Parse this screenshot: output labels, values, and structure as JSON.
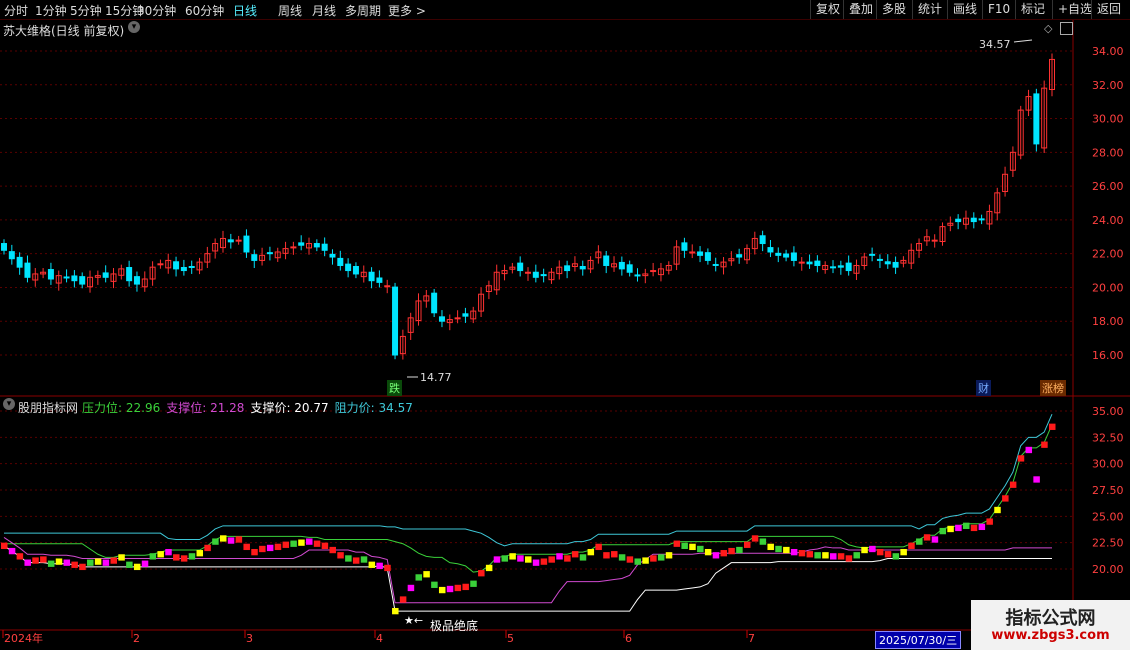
{
  "toolbar": {
    "periods": [
      "分时",
      "1分钟",
      "5分钟",
      "15分钟",
      "30分钟",
      "60分钟",
      "日线",
      "周线",
      "月线",
      "多周期",
      "更多 >"
    ],
    "active_period": "日线",
    "right_buttons": [
      "复权",
      "叠加",
      "多股",
      "统计",
      "画线",
      "F10",
      "标记",
      "+自选",
      "返回"
    ]
  },
  "main_chart": {
    "title": "苏大维格(日线 前复权)",
    "price_axis": [
      "34.00",
      "32.00",
      "30.00",
      "28.00",
      "26.00",
      "24.00",
      "22.00",
      "20.00",
      "18.00",
      "16.00"
    ],
    "high_marker": "34.57",
    "low_marker": "14.77",
    "badges": {
      "fall": "跌",
      "finance": "财",
      "limit_list": "涨榜"
    }
  },
  "indicator": {
    "name": "股朋指标网",
    "items": [
      {
        "label": "压力位:",
        "value": "22.96",
        "color": "#3ad13a"
      },
      {
        "label": "支撑位:",
        "value": "21.28",
        "color": "#d04ad0"
      },
      {
        "label": "支撑价:",
        "value": "20.77",
        "color": "#ffffff"
      },
      {
        "label": "阻力价:",
        "value": "34.57",
        "color": "#3ec8d8"
      }
    ],
    "axis": [
      "35.00",
      "32.50",
      "30.00",
      "27.50",
      "25.00",
      "22.50",
      "20.00"
    ],
    "annotation": "极品绝底"
  },
  "time_axis": {
    "labels": [
      "2024年",
      "2",
      "3",
      "4",
      "5",
      "6",
      "7"
    ],
    "cursor_date": "2025/07/30/三"
  },
  "watermark": {
    "title": "指标公式网",
    "url": "www.zbgs3.com"
  },
  "colors": {
    "up": "#ff3232",
    "down": "#00e5ff",
    "grid": "#5a0000",
    "axis_text": "#ff4040"
  },
  "series": {
    "closes": [
      22.2,
      21.7,
      21.2,
      20.6,
      20.8,
      20.9,
      20.5,
      20.7,
      20.6,
      20.4,
      20.2,
      20.6,
      20.7,
      20.6,
      20.8,
      21.1,
      20.4,
      20.2,
      20.5,
      21.2,
      21.4,
      21.6,
      21.1,
      21.0,
      21.2,
      21.5,
      22.0,
      22.6,
      22.9,
      22.7,
      22.8,
      22.1,
      21.6,
      21.9,
      22.0,
      22.1,
      22.3,
      22.4,
      22.5,
      22.6,
      22.4,
      22.2,
      21.8,
      21.3,
      21.0,
      20.8,
      20.9,
      20.4,
      20.3,
      20.1,
      16.0,
      17.1,
      18.2,
      19.2,
      19.5,
      18.5,
      18.0,
      18.1,
      18.2,
      18.3,
      18.6,
      19.6,
      20.1,
      20.9,
      21.0,
      21.2,
      21.0,
      20.9,
      20.6,
      20.7,
      20.9,
      21.2,
      21.0,
      21.4,
      21.1,
      21.6,
      22.1,
      21.3,
      21.4,
      21.1,
      20.9,
      20.7,
      20.8,
      21.0,
      21.1,
      21.3,
      22.4,
      22.2,
      22.1,
      21.9,
      21.6,
      21.3,
      21.5,
      21.7,
      21.8,
      22.3,
      22.9,
      22.6,
      22.1,
      21.9,
      21.8,
      21.6,
      21.5,
      21.4,
      21.3,
      21.3,
      21.2,
      21.2,
      21.0,
      21.3,
      21.8,
      21.9,
      21.6,
      21.4,
      21.2,
      21.6,
      22.2,
      22.6,
      23.0,
      22.8,
      23.6,
      23.8,
      23.9,
      24.1,
      23.9,
      24.0,
      24.5,
      25.6,
      26.7,
      28.0,
      30.5,
      31.3,
      28.5,
      31.8,
      33.5
    ]
  }
}
